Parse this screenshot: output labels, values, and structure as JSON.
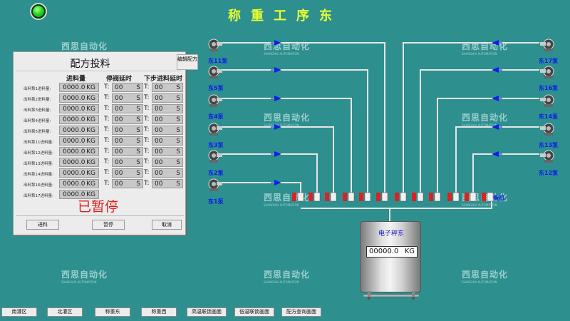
{
  "header": {
    "title": "称重工序东"
  },
  "panel": {
    "title": "配方投料",
    "edit_button": "编辑配方",
    "columns": {
      "quantity": "进料量",
      "valve_delay": "停阀延时",
      "next_delay": "下步进料延时"
    },
    "rows": [
      {
        "label": "出料泵1进料量:",
        "qty": "0000.0",
        "unit": "KG",
        "t_label": "T:",
        "delay": "00",
        "delay_unit": "S",
        "next": "00",
        "next_unit": "S"
      },
      {
        "label": "出料泵2进料量:",
        "qty": "0000.0",
        "unit": "KG",
        "t_label": "T:",
        "delay": "00",
        "delay_unit": "S",
        "next": "00",
        "next_unit": "S"
      },
      {
        "label": "出料泵3进料量:",
        "qty": "0000.0",
        "unit": "KG",
        "t_label": "T:",
        "delay": "00",
        "delay_unit": "S",
        "next": "00",
        "next_unit": "S"
      },
      {
        "label": "出料泵4进料量:",
        "qty": "0000.0",
        "unit": "KG",
        "t_label": "T:",
        "delay": "00",
        "delay_unit": "S",
        "next": "00",
        "next_unit": "S"
      },
      {
        "label": "出料泵5进料量:",
        "qty": "0000.0",
        "unit": "KG",
        "t_label": "T:",
        "delay": "00",
        "delay_unit": "S",
        "next": "00",
        "next_unit": "S"
      },
      {
        "label": "出料泵11进料量:",
        "qty": "0000.0",
        "unit": "KG",
        "t_label": "T:",
        "delay": "00",
        "delay_unit": "S",
        "next": "00",
        "next_unit": "S"
      },
      {
        "label": "出料泵12进料量:",
        "qty": "0000.0",
        "unit": "KG",
        "t_label": "T:",
        "delay": "00",
        "delay_unit": "S",
        "next": "00",
        "next_unit": "S"
      },
      {
        "label": "出料泵13进料量:",
        "qty": "0000.0",
        "unit": "KG",
        "t_label": "T:",
        "delay": "00",
        "delay_unit": "S",
        "next": "00",
        "next_unit": "S"
      },
      {
        "label": "出料泵14进料量:",
        "qty": "0000.0",
        "unit": "KG",
        "t_label": "T:",
        "delay": "00",
        "delay_unit": "S",
        "next": "00",
        "next_unit": "S"
      },
      {
        "label": "出料泵16进料量:",
        "qty": "0000.0",
        "unit": "KG",
        "t_label": "T:",
        "delay": "00",
        "delay_unit": "S",
        "next": "00",
        "next_unit": "S"
      },
      {
        "label": "出料泵17进料量:",
        "qty": "0000.0",
        "unit": "KG"
      }
    ],
    "status": "已暂停",
    "buttons": {
      "feed": "进料",
      "pause": "暂停",
      "cancel": "取消"
    }
  },
  "pumps_left": [
    {
      "label": "东11泵"
    },
    {
      "label": "东5泵"
    },
    {
      "label": "东4泵"
    },
    {
      "label": "东3泵"
    },
    {
      "label": "东2泵"
    },
    {
      "label": "东1泵"
    }
  ],
  "pumps_right": [
    {
      "label": "东17泵"
    },
    {
      "label": "东16泵"
    },
    {
      "label": "东14泵"
    },
    {
      "label": "东13泵"
    },
    {
      "label": "东12泵"
    }
  ],
  "scale": {
    "label": "电子秤东",
    "value": "00000.0",
    "unit": "KG"
  },
  "standby_label": "备机",
  "watermark": {
    "text": "西思自动化",
    "sub": "SHANGHAI AUTOMATION"
  },
  "nav": [
    "南灌区",
    "北灌区",
    "称重东",
    "称重西",
    "高温联锁画面",
    "低温联锁画面",
    "配方查询画面"
  ],
  "colors": {
    "background": "#2e8f8f",
    "pipe": "#e6e6e6",
    "arrow": "#1020e0",
    "valve_red": "#e02020",
    "pump_label": "#0a1aee"
  }
}
